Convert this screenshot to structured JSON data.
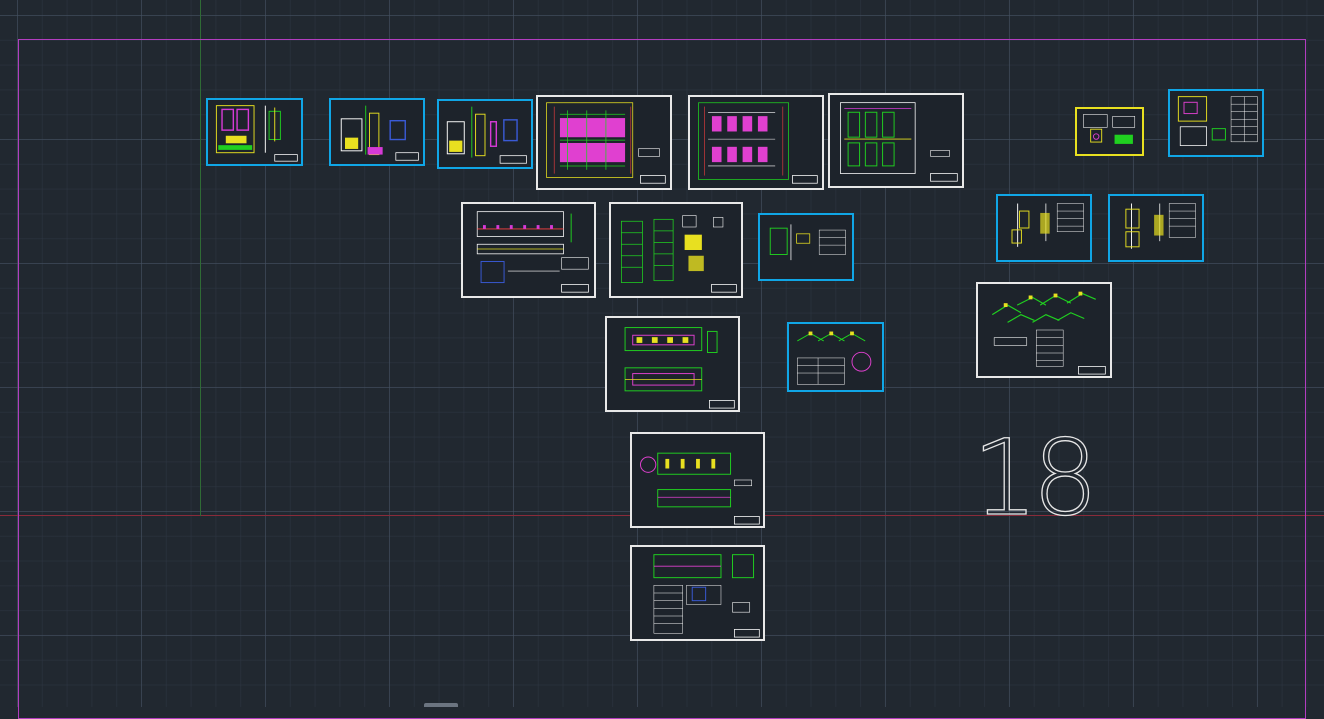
{
  "viewport": {
    "background_color": "#212830",
    "grid_major_color": "#465262",
    "grid_minor_color": "#303946",
    "x_axis_color": "#8a2b3a",
    "y_axis_color": "#2f6b35",
    "limits_color": "#b23dbf"
  },
  "sheet_frame_colors": {
    "white": "#e8e8e8",
    "cyan": "#10a6e6",
    "yellow": "#e8e020"
  },
  "annotation": {
    "sheet_count_label": "18"
  }
}
